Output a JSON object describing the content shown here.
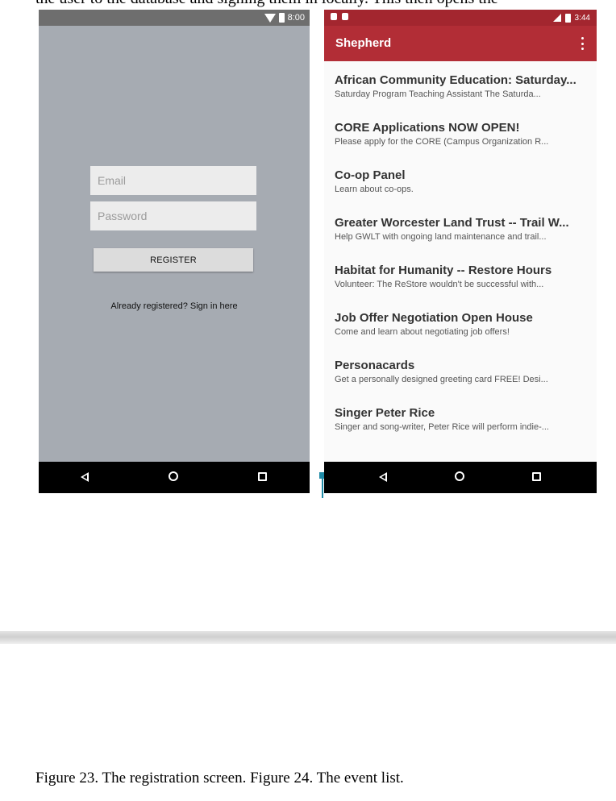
{
  "top_text": "the user to the database and signing them in locally. This then opens the",
  "registration": {
    "status_time": "8:00",
    "email_placeholder": "Email",
    "password_placeholder": "Password",
    "register_label": "REGISTER",
    "signin_link": "Already registered? Sign in here"
  },
  "event_app": {
    "status_time": "3:44",
    "title": "Shepherd",
    "events": [
      {
        "title": "African Community Education: Saturday...",
        "desc": "Saturday Program Teaching Assistant  The Saturda..."
      },
      {
        "title": "CORE Applications NOW OPEN!",
        "desc": "Please apply for the CORE (Campus Organization R..."
      },
      {
        "title": "Co-op Panel",
        "desc": "Learn about co-ops."
      },
      {
        "title": "Greater Worcester Land Trust -- Trail W...",
        "desc": "Help GWLT with ongoing land maintenance and trail..."
      },
      {
        "title": "Habitat for Humanity -- Restore Hours",
        "desc": "Volunteer: The ReStore wouldn't be successful with..."
      },
      {
        "title": "Job Offer Negotiation Open House",
        "desc": "Come and learn about negotiating job offers!"
      },
      {
        "title": "Personacards",
        "desc": "Get a personally designed greeting card FREE!  Desi..."
      },
      {
        "title": "Singer Peter Rice",
        "desc": "Singer and song-writer, Peter Rice will perform indie-..."
      }
    ]
  },
  "caption": "Figure 23. The registration screen. Figure 24. The event list.",
  "colors": {
    "app_bar": "#b22d36",
    "status_bar_app": "#a3262f",
    "registration_bg": "#a6abb2",
    "nav_bar": "#000000",
    "marker": "#1f8aa6"
  },
  "icons": [
    "wifi-icon",
    "battery-icon",
    "back-icon",
    "home-icon",
    "recents-icon",
    "overflow-menu-icon",
    "signal-icon",
    "notification-icon"
  ]
}
